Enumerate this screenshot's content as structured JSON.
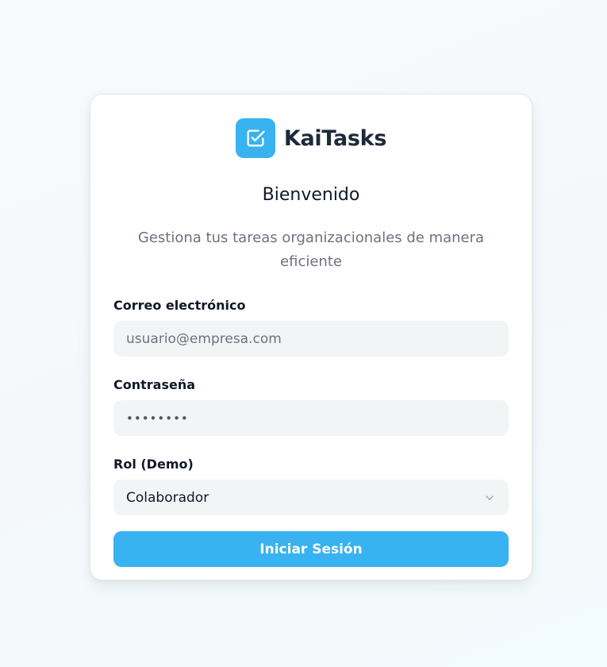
{
  "brand": {
    "name": "KaiTasks",
    "logo_icon": "check-square-icon",
    "accent_color": "#38b2f0"
  },
  "header": {
    "title": "Bienvenido",
    "subtitle": "Gestiona tus tareas organizacionales de manera eficiente"
  },
  "form": {
    "email": {
      "label": "Correo electrónico",
      "placeholder": "usuario@empresa.com",
      "value": ""
    },
    "password": {
      "label": "Contraseña",
      "masked_value": "••••••••"
    },
    "role": {
      "label": "Rol (Demo)",
      "selected": "Colaborador",
      "icon": "chevron-down-icon"
    },
    "submit_label": "Iniciar Sesión"
  }
}
